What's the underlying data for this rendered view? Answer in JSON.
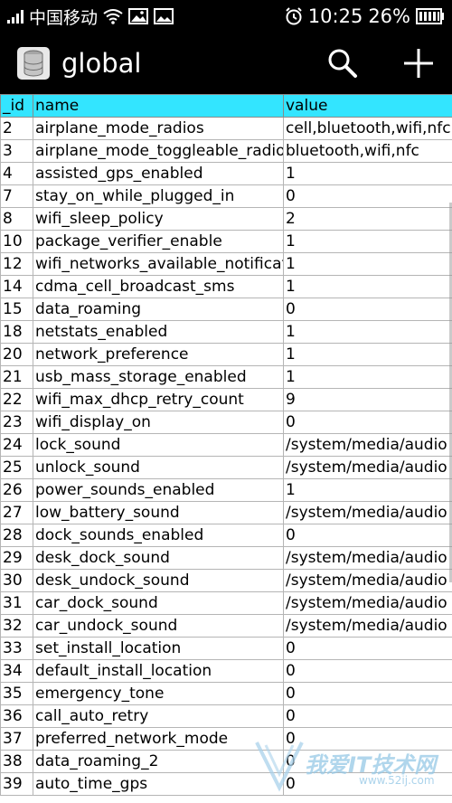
{
  "status_bar": {
    "carrier": "中国移动",
    "time": "10:25",
    "battery": "26%",
    "icons": [
      "signal-icon",
      "wifi-icon",
      "gallery-icon",
      "image-icon",
      "alarm-icon",
      "battery-icon"
    ]
  },
  "action_bar": {
    "title": "global",
    "app_icon": "database-icon",
    "actions": [
      "search-icon",
      "add-icon"
    ]
  },
  "table": {
    "headers": [
      "_id",
      "name",
      "value"
    ],
    "rows": [
      {
        "id": "2",
        "name": "airplane_mode_radios",
        "value": "cell,bluetooth,wifi,nfc"
      },
      {
        "id": "3",
        "name": "airplane_mode_toggleable_radios",
        "value": "bluetooth,wifi,nfc"
      },
      {
        "id": "4",
        "name": "assisted_gps_enabled",
        "value": "1"
      },
      {
        "id": "7",
        "name": "stay_on_while_plugged_in",
        "value": "0"
      },
      {
        "id": "8",
        "name": "wifi_sleep_policy",
        "value": "2"
      },
      {
        "id": "10",
        "name": "package_verifier_enable",
        "value": "1"
      },
      {
        "id": "12",
        "name": "wifi_networks_available_notification_on",
        "value": "1"
      },
      {
        "id": "14",
        "name": "cdma_cell_broadcast_sms",
        "value": "1"
      },
      {
        "id": "15",
        "name": "data_roaming",
        "value": "0"
      },
      {
        "id": "18",
        "name": "netstats_enabled",
        "value": "1"
      },
      {
        "id": "20",
        "name": "network_preference",
        "value": "1"
      },
      {
        "id": "21",
        "name": "usb_mass_storage_enabled",
        "value": "1"
      },
      {
        "id": "22",
        "name": "wifi_max_dhcp_retry_count",
        "value": "9"
      },
      {
        "id": "23",
        "name": "wifi_display_on",
        "value": "0"
      },
      {
        "id": "24",
        "name": "lock_sound",
        "value": "/system/media/audio"
      },
      {
        "id": "25",
        "name": "unlock_sound",
        "value": "/system/media/audio"
      },
      {
        "id": "26",
        "name": "power_sounds_enabled",
        "value": "1"
      },
      {
        "id": "27",
        "name": "low_battery_sound",
        "value": "/system/media/audio"
      },
      {
        "id": "28",
        "name": "dock_sounds_enabled",
        "value": "0"
      },
      {
        "id": "29",
        "name": "desk_dock_sound",
        "value": "/system/media/audio"
      },
      {
        "id": "30",
        "name": "desk_undock_sound",
        "value": "/system/media/audio"
      },
      {
        "id": "31",
        "name": "car_dock_sound",
        "value": "/system/media/audio"
      },
      {
        "id": "32",
        "name": "car_undock_sound",
        "value": "/system/media/audio"
      },
      {
        "id": "33",
        "name": "set_install_location",
        "value": "0"
      },
      {
        "id": "34",
        "name": "default_install_location",
        "value": "0"
      },
      {
        "id": "35",
        "name": "emergency_tone",
        "value": "0"
      },
      {
        "id": "36",
        "name": "call_auto_retry",
        "value": "0"
      },
      {
        "id": "37",
        "name": "preferred_network_mode",
        "value": "0"
      },
      {
        "id": "38",
        "name": "data_roaming_2",
        "value": "0"
      },
      {
        "id": "39",
        "name": "auto_time_gps",
        "value": "0"
      }
    ]
  },
  "watermark": {
    "text": "我爱IT技术网",
    "sub": "www.52ij.com"
  },
  "colors": {
    "header_bg": "#33e5ff",
    "bar_bg": "#000000"
  }
}
